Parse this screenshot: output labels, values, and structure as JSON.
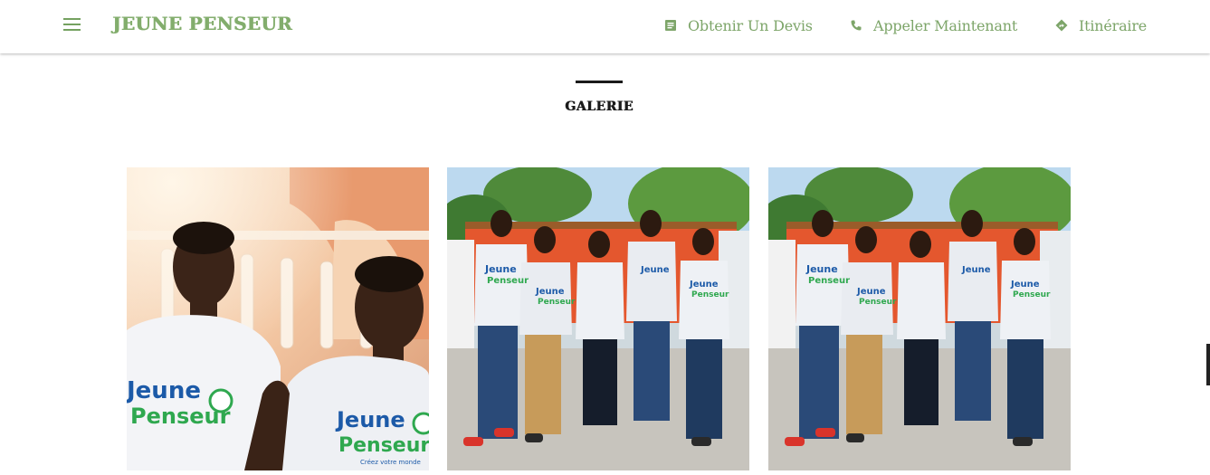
{
  "header": {
    "brand": "JEUNE PENSEUR",
    "nav": [
      {
        "label": "Obtenir Un Devis",
        "icon": "document-icon"
      },
      {
        "label": "Appeler Maintenant",
        "icon": "phone-icon"
      },
      {
        "label": "Itinéraire",
        "icon": "directions-icon"
      }
    ],
    "menu_icon": "hamburger-menu-icon"
  },
  "gallery": {
    "title": "GALERIE",
    "images": [
      {
        "shirt_top": "Jeune",
        "shirt_bottom": "Penseur",
        "caption": "Créez votre monde"
      },
      {
        "shirt_top": "Jeune",
        "shirt_bottom": "Penseur"
      },
      {
        "shirt_top": "Jeune",
        "shirt_bottom": "Penseur"
      }
    ]
  },
  "colors": {
    "accent_green": "#7da569",
    "shirt_blue": "#1c5aa8",
    "shirt_green": "#2fa84f",
    "title_black": "#1b1b1b"
  }
}
